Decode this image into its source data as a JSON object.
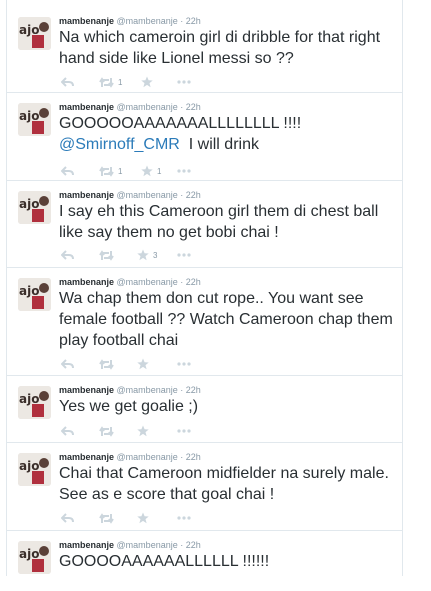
{
  "tweets": [
    {
      "name": "mambenanje",
      "handle": "@mambenanje",
      "dot": "·",
      "time": "22h",
      "text": "Na which cameroin girl di dribble for that right hand side like Lionel messi so ??",
      "retweets": "1",
      "favorites": ""
    },
    {
      "name": "mambenanje",
      "handle": "@mambenanje",
      "dot": "·",
      "time": "22h",
      "text": "GOOOOOAAAAAAALLLLLLLL !!!!",
      "mention": "@Smirnoff_CMR",
      "text_after": "I will drink",
      "retweets": "1",
      "favorites": "1"
    },
    {
      "name": "mambenanje",
      "handle": "@mambenanje",
      "dot": "·",
      "time": "22h",
      "text": "I say eh this Cameroon girl them di chest ball like say them no get bobi chai !",
      "retweets": "",
      "favorites": "3"
    },
    {
      "name": "mambenanje",
      "handle": "@mambenanje",
      "dot": "·",
      "time": "22h",
      "text": "Wa chap them don cut rope.. You want see female football ?? Watch Cameroon chap them play football chai",
      "retweets": "",
      "favorites": ""
    },
    {
      "name": "mambenanje",
      "handle": "@mambenanje",
      "dot": "·",
      "time": "22h",
      "text": "Yes we get goalie ;)",
      "retweets": "",
      "favorites": ""
    },
    {
      "name": "mambenanje",
      "handle": "@mambenanje",
      "dot": "·",
      "time": "22h",
      "text": "Chai that Cameroon midfielder na surely male. See as e score that goal chai !",
      "retweets": "",
      "favorites": ""
    },
    {
      "name": "mambenanje",
      "handle": "@mambenanje",
      "dot": "·",
      "time": "22h",
      "text": "GOOOOAAAAAALLLLLL !!!!!!",
      "retweets": "",
      "favorites": ""
    }
  ],
  "icons": {
    "reply": "reply-icon",
    "retweet": "retweet-icon",
    "favorite": "star-icon",
    "more": "more-icon"
  },
  "colors": {
    "text": "#292f33",
    "muted": "#8899a6",
    "link": "#2b7bb9",
    "border": "#e1e8ed",
    "icon": "#ccd6dd"
  }
}
